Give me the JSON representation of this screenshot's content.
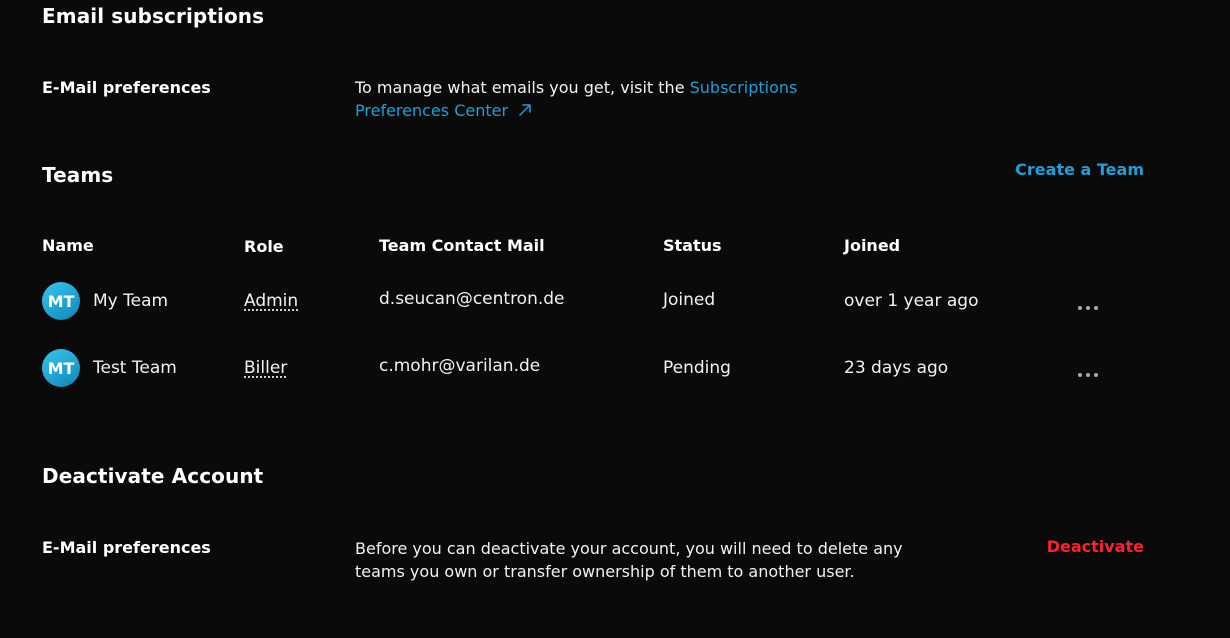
{
  "email_subscriptions": {
    "title": "Email subscriptions",
    "row_label": "E-Mail preferences",
    "text": "To manage what emails you get, visit the ",
    "link_label": "Subscriptions Preferences Center",
    "link_icon": "external-arrow-icon"
  },
  "teams": {
    "title": "Teams",
    "create_label": "Create a Team",
    "columns": [
      "Name",
      "Role",
      "Team Contact Mail",
      "Status",
      "Joined"
    ],
    "rows": [
      {
        "initials": "MT",
        "name": "My Team",
        "role": "Admin",
        "mail": "d.seucan@centron.de",
        "status": "Joined",
        "joined": "over 1 year ago"
      },
      {
        "initials": "MT",
        "name": "Test Team",
        "role": "Biller",
        "mail": "c.mohr@varilan.de",
        "status": "Pending",
        "joined": "23 days ago"
      }
    ]
  },
  "deactivate": {
    "title": "Deactivate Account",
    "row_label": "E-Mail preferences",
    "text": "Before you can deactivate your account, you will need to delete any teams you own or transfer ownership of them to another user.",
    "action_label": "Deactivate"
  },
  "colors": {
    "background": "#0a0a0b",
    "accent": "#1f9fd6",
    "danger": "#ff1f2d"
  }
}
